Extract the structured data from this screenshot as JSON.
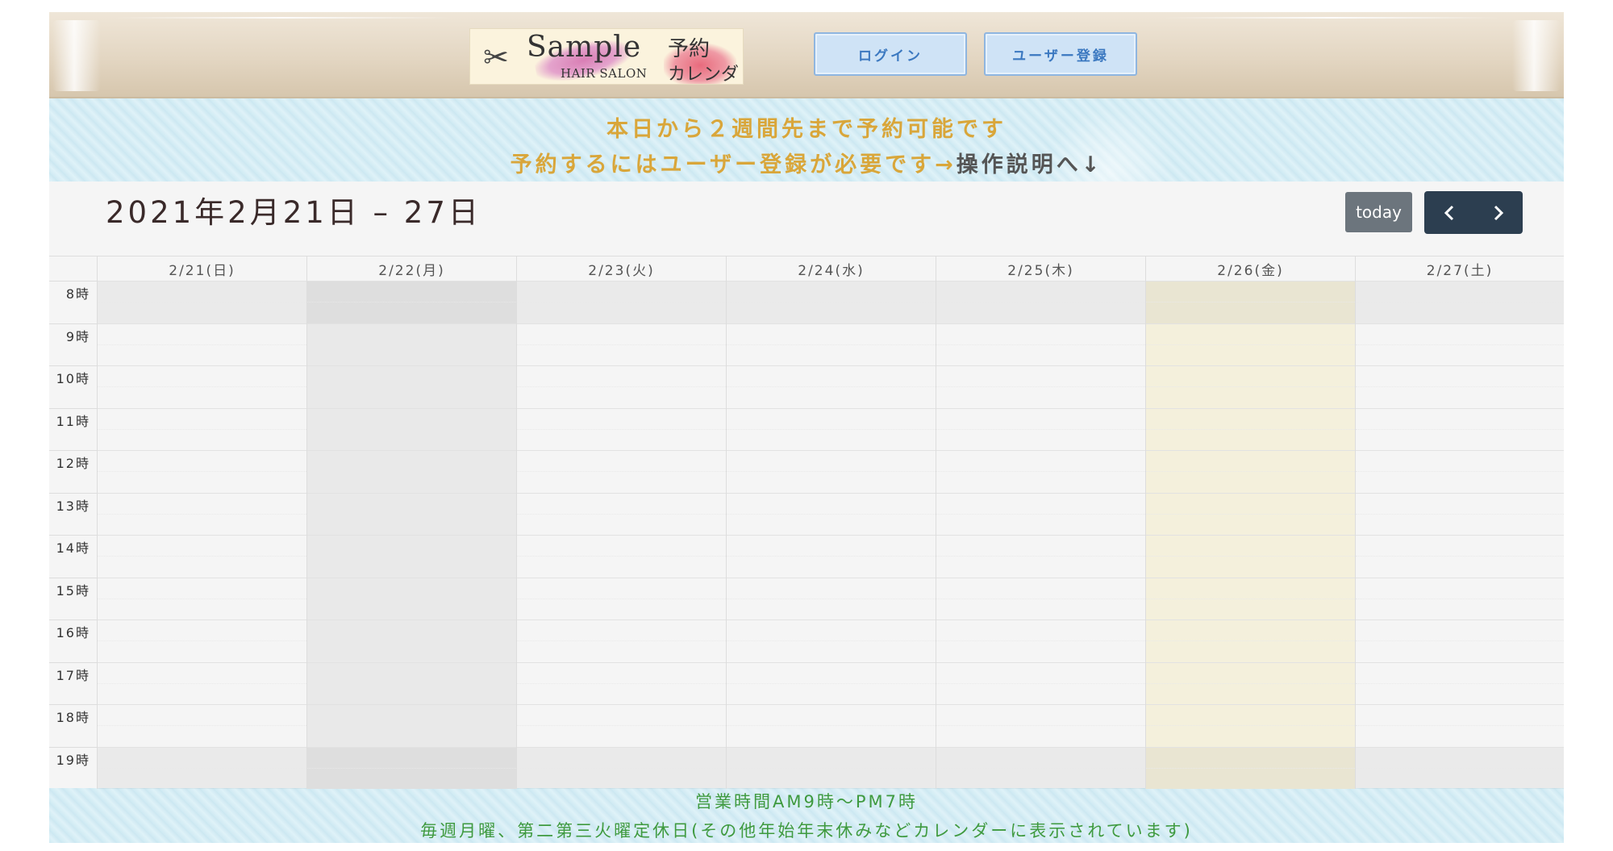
{
  "header": {
    "logo": {
      "title": "Sample",
      "subtitle": "HAIR SALON",
      "tag_line1": "予約",
      "tag_line2": "カレンダー"
    },
    "login_label": "ログイン",
    "register_label": "ユーザー登録"
  },
  "notice": {
    "line1": "本日から２週間先まで予約可能です",
    "line2_main": "予約するにはユーザー登録が必要です→",
    "line2_link": "操作説明へ↓"
  },
  "calendar": {
    "title": "2021年2月21日 – 27日",
    "today_label": "today",
    "prev_icon": "chevron-left-icon",
    "next_icon": "chevron-right-icon",
    "days": [
      {
        "label": "2/21(日)",
        "state": "normal"
      },
      {
        "label": "2/22(月)",
        "state": "closed"
      },
      {
        "label": "2/23(火)",
        "state": "normal"
      },
      {
        "label": "2/24(水)",
        "state": "normal"
      },
      {
        "label": "2/25(木)",
        "state": "normal"
      },
      {
        "label": "2/26(金)",
        "state": "today"
      },
      {
        "label": "2/27(土)",
        "state": "normal"
      }
    ],
    "hours": [
      "8時",
      "9時",
      "10時",
      "11時",
      "12時",
      "13時",
      "14時",
      "15時",
      "16時",
      "17時",
      "18時",
      "19時"
    ]
  },
  "footer": {
    "hours_text": "営業時間AM9時〜PM7時",
    "closed_text": "毎週月曜、第二第三火曜定休日(その他年始年末休みなどカレンダーに表示されています)"
  },
  "colors": {
    "notice": "#d9a63a",
    "footer": "#3f9a3f",
    "today_highlight": "#f4f0dc",
    "nav_button": "#2c3e50",
    "today_button": "#6c757d",
    "header_button": "#cfe3f6"
  }
}
